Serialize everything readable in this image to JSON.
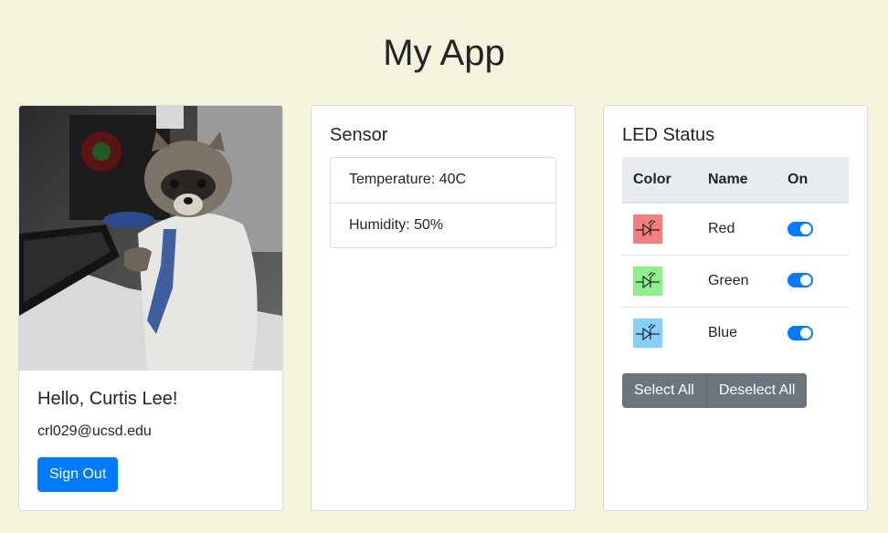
{
  "app": {
    "title": "My App"
  },
  "profile": {
    "greeting": "Hello, Curtis Lee!",
    "email": "crl029@ucsd.edu",
    "sign_out_label": "Sign Out",
    "photo_subject": "raccoon-in-shirt-and-tie-at-computer"
  },
  "sensor": {
    "title": "Sensor",
    "readings": [
      {
        "label": "Temperature: 40C"
      },
      {
        "label": "Humidity: 50%"
      }
    ]
  },
  "led": {
    "title": "LED Status",
    "columns": [
      "Color",
      "Name",
      "On"
    ],
    "rows": [
      {
        "name": "Red",
        "color": "#f08080",
        "on": true
      },
      {
        "name": "Green",
        "color": "#90ee90",
        "on": true
      },
      {
        "name": "Blue",
        "color": "#87cefa",
        "on": true
      }
    ],
    "select_all_label": "Select All",
    "deselect_all_label": "Deselect All"
  },
  "colors": {
    "background": "#f5f3dc",
    "primary": "#007bff",
    "secondary": "#6c757d"
  }
}
